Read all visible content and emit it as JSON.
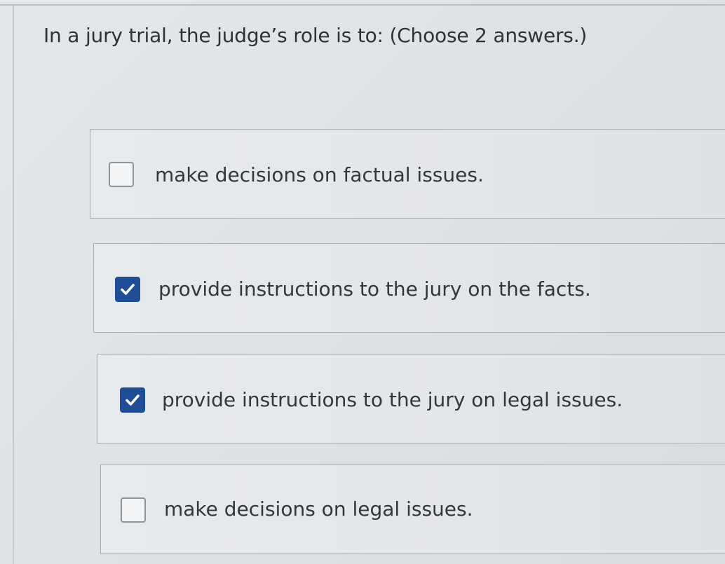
{
  "question": {
    "text": "In a jury trial, the judge’s role is to: (Choose 2 answers.)"
  },
  "options": [
    {
      "label": "make decisions on factual issues.",
      "checked": false
    },
    {
      "label": "provide instructions to the jury on the facts.",
      "checked": true
    },
    {
      "label": "provide instructions to the jury on legal issues.",
      "checked": true
    },
    {
      "label": "make decisions on legal issues.",
      "checked": false
    }
  ],
  "colors": {
    "checkbox_checked": "#1f4e96",
    "checkmark": "#ffffff"
  }
}
